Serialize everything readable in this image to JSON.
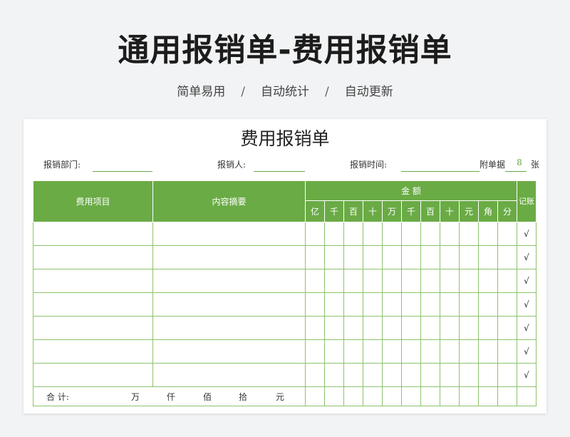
{
  "banner": {
    "title": "通用报销单-费用报销单",
    "tags": [
      "简单易用",
      "自动统计",
      "自动更新"
    ],
    "separator": "/"
  },
  "form": {
    "title": "费用报销单",
    "dept_label": "报销部门:",
    "person_label": "报销人:",
    "time_label": "报销时间:",
    "attach_label": "附单据",
    "attach_value": "8",
    "attach_unit": "张",
    "headers": {
      "item": "费用项目",
      "summary": "内容摘要",
      "amount": "金 额",
      "record": "记账",
      "digits": [
        "亿",
        "千",
        "百",
        "十",
        "万",
        "千",
        "百",
        "十",
        "元",
        "角",
        "分"
      ]
    },
    "rows": [
      {
        "check": "√"
      },
      {
        "check": "√"
      },
      {
        "check": "√"
      },
      {
        "check": "√"
      },
      {
        "check": "√"
      },
      {
        "check": "√"
      },
      {
        "check": "√"
      }
    ],
    "total": {
      "label": "合 计:",
      "units": [
        "万",
        "仟",
        "佰",
        "拾",
        "元"
      ]
    }
  },
  "colors": {
    "header_green": "#6aab45",
    "line_green": "#8cc36b",
    "background": "#f2f3f5"
  }
}
